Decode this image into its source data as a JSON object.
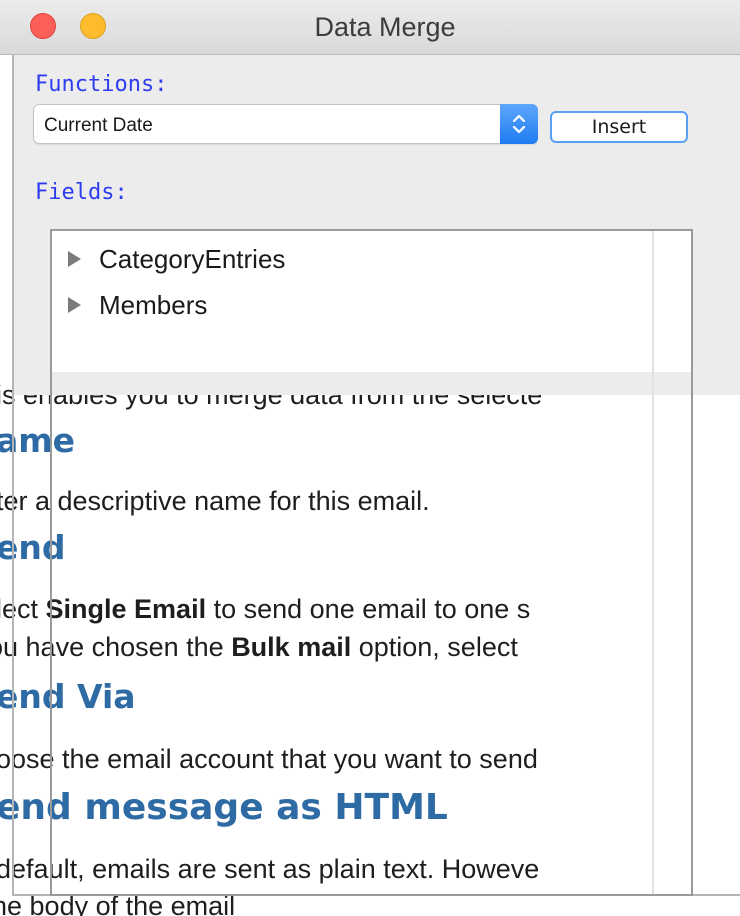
{
  "window": {
    "title": "Data Merge"
  },
  "functions": {
    "label": "Functions:",
    "selected": "Current Date",
    "insert_label": "Insert"
  },
  "fields": {
    "label": "Fields:",
    "items": [
      {
        "label": "CategoryEntries"
      },
      {
        "label": "Members"
      }
    ]
  },
  "help_doc": {
    "intro": "is enables you to merge data from the selecte",
    "name_heading": "ame",
    "name_text": "ter a descriptive name for this email.",
    "send_heading": "end",
    "send_line1_pre": "lect ",
    "send_line1_bold": "Single Email",
    "send_line1_post": " to send one email to one s",
    "send_line2_pre": "ou have chosen the ",
    "send_line2_bold": "Bulk mail",
    "send_line2_post": " option, select",
    "send_via_heading": "end Via",
    "send_via_text": "oose the email account that you want to send",
    "html_heading": "end message as HTML",
    "html_text": "default, emails are sent as plain text. Howeve",
    "html_text2": "he body of the email"
  },
  "colors": {
    "heading": "#2e6aa3",
    "section_label": "#2f3df0",
    "accent": "#1e7cf2"
  }
}
